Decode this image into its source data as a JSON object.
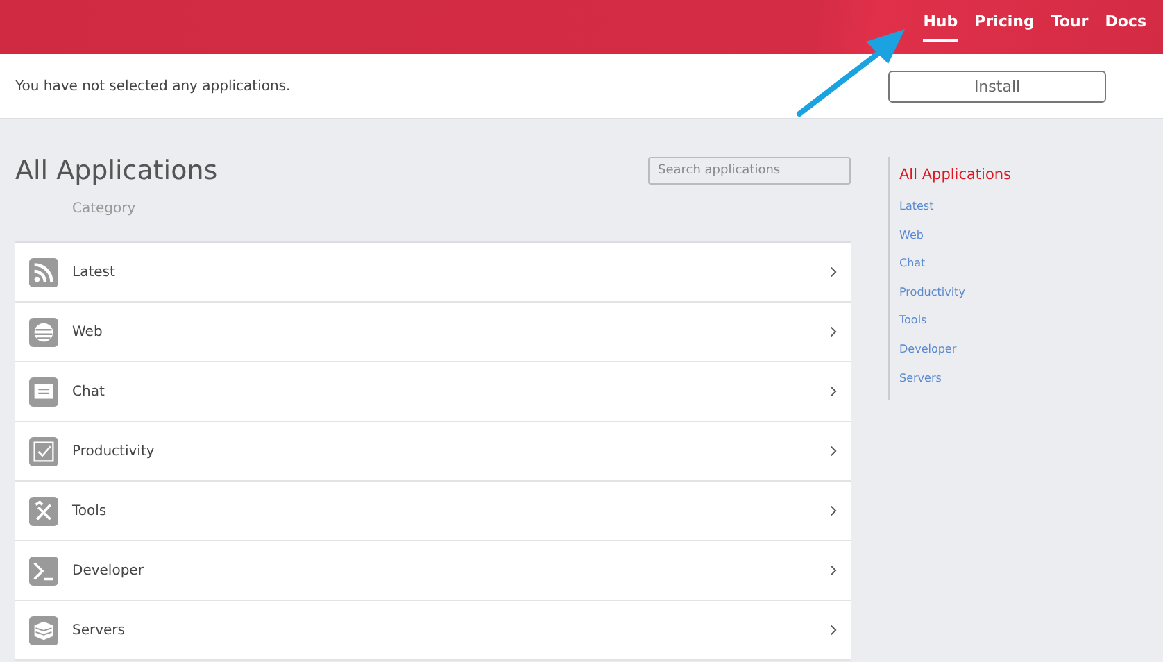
{
  "nav": [
    {
      "label": "Hub",
      "selected": true
    },
    {
      "label": "Pricing",
      "selected": false
    },
    {
      "label": "Tour",
      "selected": false
    },
    {
      "label": "Docs",
      "selected": false
    }
  ],
  "selection_bar": {
    "message": "You have not selected any applications.",
    "button": "Install"
  },
  "title": "All Applications",
  "search": {
    "placeholder": "Search applications"
  },
  "column_header": "Category",
  "categories": [
    {
      "label": "Latest",
      "kind": "rss"
    },
    {
      "label": "Web",
      "kind": "globe"
    },
    {
      "label": "Chat",
      "kind": "chat"
    },
    {
      "label": "Productivity",
      "kind": "check"
    },
    {
      "label": "Tools",
      "kind": "tools"
    },
    {
      "label": "Developer",
      "kind": "terminal"
    },
    {
      "label": "Servers",
      "kind": "stack"
    }
  ],
  "sidebar": {
    "items": [
      {
        "label": "All Applications",
        "selected": true
      },
      {
        "label": "Latest",
        "selected": false
      },
      {
        "label": "Web",
        "selected": false
      },
      {
        "label": "Chat",
        "selected": false
      },
      {
        "label": "Productivity",
        "selected": false
      },
      {
        "label": "Tools",
        "selected": false
      },
      {
        "label": "Developer",
        "selected": false
      },
      {
        "label": "Servers",
        "selected": false
      }
    ]
  }
}
